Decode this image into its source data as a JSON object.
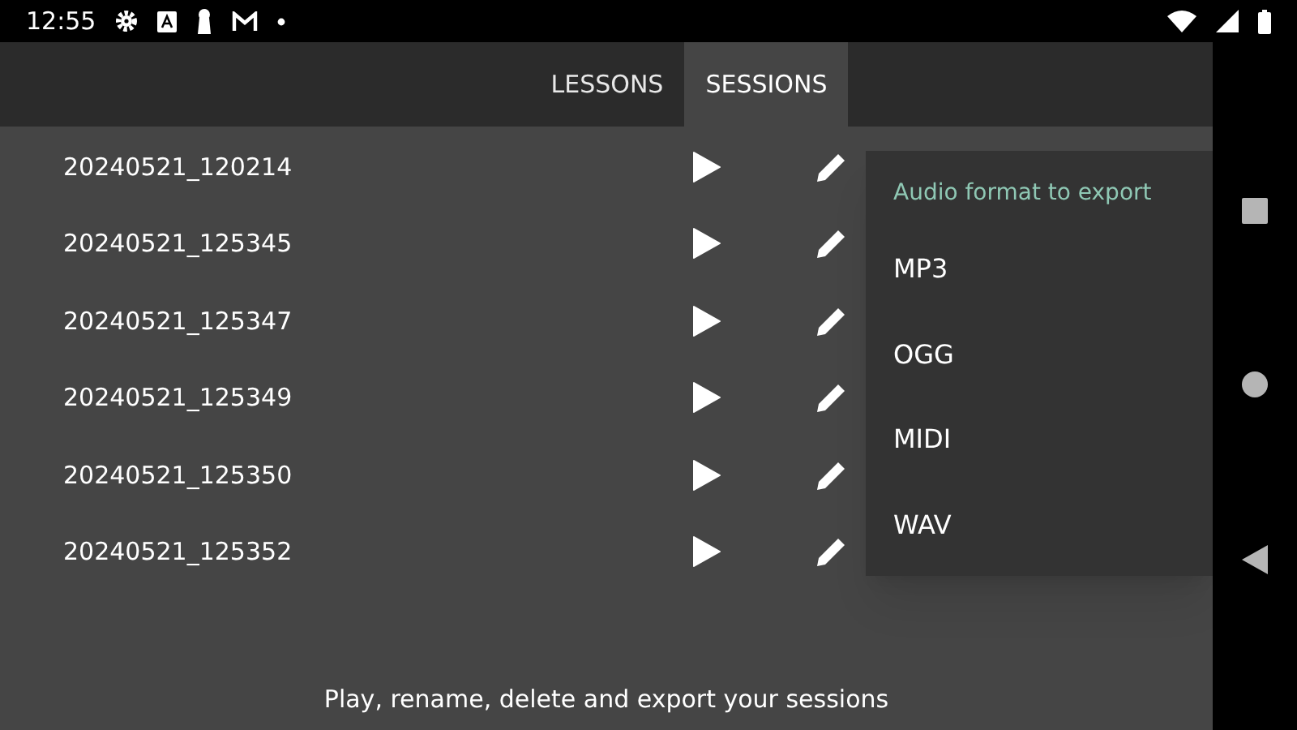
{
  "status_bar": {
    "time": "12:55"
  },
  "tabs": [
    {
      "label": "LESSONS",
      "selected": false
    },
    {
      "label": "SESSIONS",
      "selected": true
    }
  ],
  "sessions": [
    {
      "name": "20240521_120214"
    },
    {
      "name": "20240521_125345"
    },
    {
      "name": "20240521_125347"
    },
    {
      "name": "20240521_125349"
    },
    {
      "name": "20240521_125350"
    },
    {
      "name": "20240521_125352"
    }
  ],
  "export_menu": {
    "title": "Audio format to export",
    "options": [
      "MP3",
      "OGG",
      "MIDI",
      "WAV"
    ]
  },
  "footer_hint": "Play, rename, delete and export your sessions"
}
